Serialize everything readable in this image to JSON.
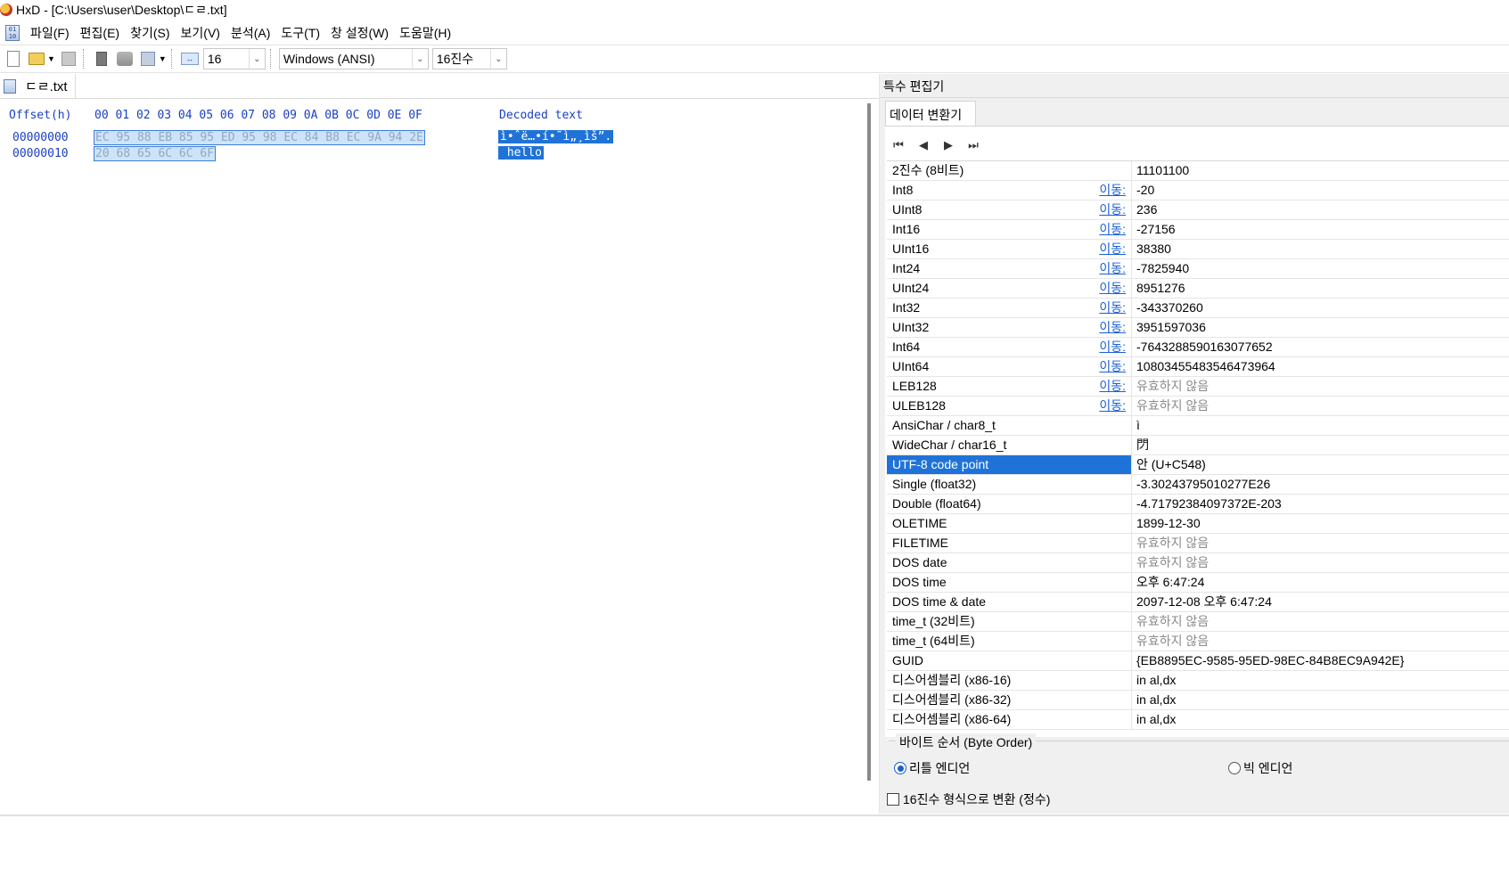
{
  "window": {
    "title": "HxD - [C:\\Users\\user\\Desktop\\ㄷㄹ.txt]"
  },
  "menu": {
    "items": [
      "파일(F)",
      "편집(E)",
      "찾기(S)",
      "보기(V)",
      "분석(A)",
      "도구(T)",
      "창 설정(W)",
      "도움말(H)"
    ]
  },
  "toolbar": {
    "bytes_per_row": "16",
    "charset": "Windows (ANSI)",
    "offset_base": "16진수"
  },
  "doc_tab": {
    "label": "ㄷㄹ.txt"
  },
  "hex": {
    "header_offset": "Offset(h)",
    "header_columns": "00 01 02 03 04 05 06 07 08 09 0A 0B 0C 0D 0E 0F",
    "header_decoded": "Decoded text",
    "rows": [
      {
        "offset": "00000000",
        "bytes": "EC 95 88 EB 85 95 ED 95 98 EC 84 B8 EC 9A 94 2E",
        "text": "ì•ˆë…•í•˜ì„¸ìš”."
      },
      {
        "offset": "00000010",
        "bytes": "20 68 65 6C 6C 6F",
        "text": " hello"
      }
    ]
  },
  "panel": {
    "title": "특수 편집기",
    "tab": "데이터 변환기",
    "nav": [
      "⏮",
      "◀",
      "▶",
      "⏭"
    ],
    "rows": [
      {
        "name": "2진수 (8비트)",
        "link": "",
        "value": "11101100"
      },
      {
        "name": "Int8",
        "link": "이동:",
        "value": "-20"
      },
      {
        "name": "UInt8",
        "link": "이동:",
        "value": "236"
      },
      {
        "name": "Int16",
        "link": "이동:",
        "value": "-27156"
      },
      {
        "name": "UInt16",
        "link": "이동:",
        "value": "38380"
      },
      {
        "name": "Int24",
        "link": "이동:",
        "value": "-7825940"
      },
      {
        "name": "UInt24",
        "link": "이동:",
        "value": "8951276"
      },
      {
        "name": "Int32",
        "link": "이동:",
        "value": "-343370260"
      },
      {
        "name": "UInt32",
        "link": "이동:",
        "value": "3951597036"
      },
      {
        "name": "Int64",
        "link": "이동:",
        "value": "-7643288590163077652"
      },
      {
        "name": "UInt64",
        "link": "이동:",
        "value": "10803455483546473964"
      },
      {
        "name": "LEB128",
        "link": "이동:",
        "value": "유효하지 않음"
      },
      {
        "name": "ULEB128",
        "link": "이동:",
        "value": "유효하지 않음"
      },
      {
        "name": "AnsiChar / char8_t",
        "link": "",
        "value": "ì"
      },
      {
        "name": "WideChar / char16_t",
        "link": "",
        "value": "閁"
      },
      {
        "name": "UTF-8 code point",
        "link": "",
        "value": "안 (U+C548)"
      },
      {
        "name": "Single (float32)",
        "link": "",
        "value": "-3.30243795010277E26"
      },
      {
        "name": "Double (float64)",
        "link": "",
        "value": "-4.71792384097372E-203"
      },
      {
        "name": "OLETIME",
        "link": "",
        "value": "1899-12-30"
      },
      {
        "name": "FILETIME",
        "link": "",
        "value": "유효하지 않음"
      },
      {
        "name": "DOS date",
        "link": "",
        "value": "유효하지 않음"
      },
      {
        "name": "DOS time",
        "link": "",
        "value": "오후 6:47:24"
      },
      {
        "name": "DOS time & date",
        "link": "",
        "value": "2097-12-08 오후 6:47:24"
      },
      {
        "name": "time_t (32비트)",
        "link": "",
        "value": "유효하지 않음"
      },
      {
        "name": "time_t (64비트)",
        "link": "",
        "value": "유효하지 않음"
      },
      {
        "name": "GUID",
        "link": "",
        "value": "{EB8895EC-9585-95ED-98EC-84B8EC9A942E}"
      },
      {
        "name": "디스어셈블리 (x86-16)",
        "link": "",
        "value": "in al,dx"
      },
      {
        "name": "디스어셈블리 (x86-32)",
        "link": "",
        "value": "in al,dx"
      },
      {
        "name": "디스어셈블리 (x86-64)",
        "link": "",
        "value": "in al,dx"
      }
    ],
    "highlight_index": 15,
    "byte_order": {
      "legend": "바이트 순서 (Byte Order)",
      "little": "리틀 엔디언",
      "big": "빅 엔디언",
      "selected": "little"
    },
    "hex_format_label": "16진수 형식으로 변환 (정수)"
  }
}
